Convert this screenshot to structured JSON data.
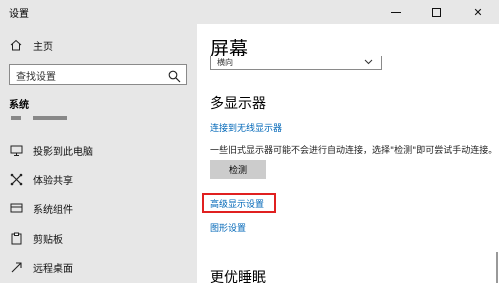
{
  "window": {
    "title": "设置",
    "minimize_label": "",
    "maximize_label": "",
    "close_label": "✕"
  },
  "sidebar": {
    "home_label": "主页",
    "search_placeholder": "查找设置",
    "section_title": "系统",
    "items": [
      {
        "label": "投影到此电脑",
        "icon": "projector-icon"
      },
      {
        "label": "体验共享",
        "icon": "share-experience-icon"
      },
      {
        "label": "系统组件",
        "icon": "components-icon"
      },
      {
        "label": "剪贴板",
        "icon": "clipboard-icon"
      },
      {
        "label": "远程桌面",
        "icon": "remote-desktop-icon"
      }
    ]
  },
  "main": {
    "title": "屏幕",
    "dropdown_value": "横向",
    "multi_display": {
      "title": "多显示器",
      "connect_link": "连接到无线显示器",
      "description": "一些旧式显示器可能不会进行自动连接，选择\"检测\"即可尝试手动连接。",
      "detect_button": "检测",
      "advanced_link": "高级显示设置",
      "graphics_link": "图形设置"
    },
    "sleep_title": "更优睡眠"
  },
  "colors": {
    "sidebar_bg": "#e7e7e7",
    "link": "#0067b8",
    "highlight_border": "#e02020",
    "button_bg": "#cccccc"
  }
}
